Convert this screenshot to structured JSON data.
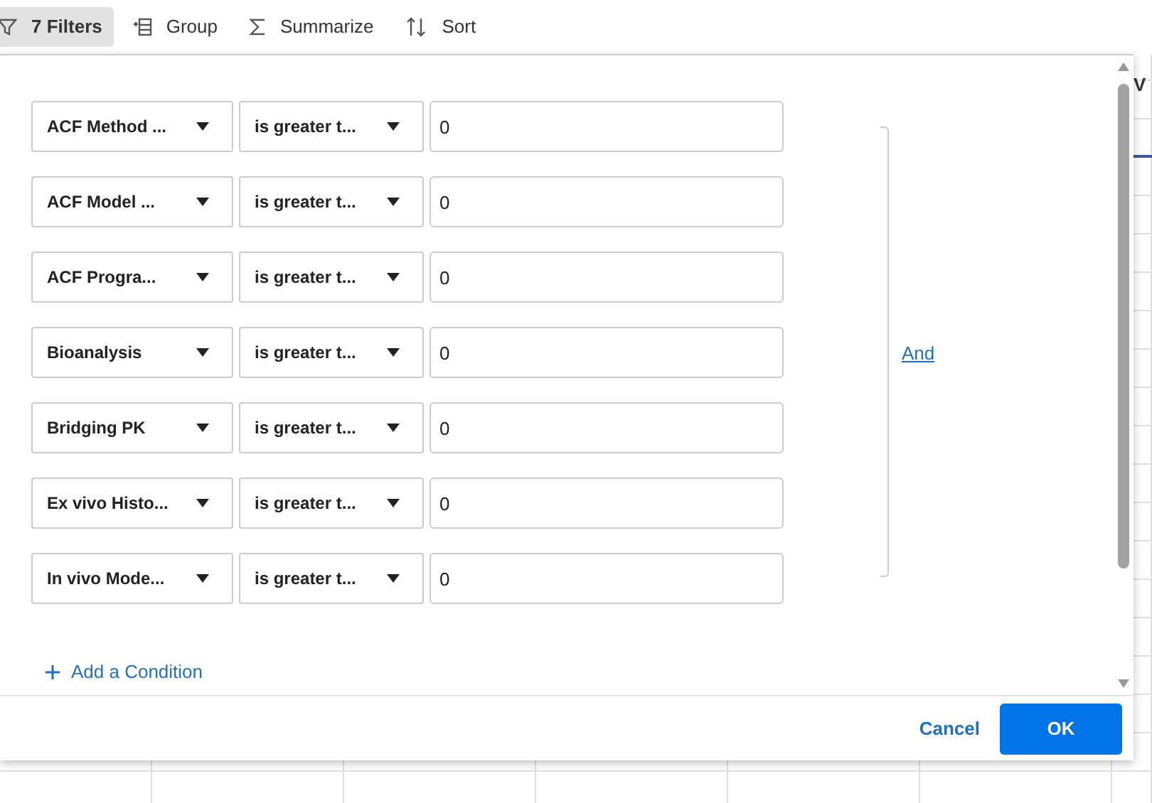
{
  "toolbar": [
    {
      "kind": "filter",
      "label": "7 Filters",
      "selected": true
    },
    {
      "kind": "group",
      "label": "Group",
      "selected": false
    },
    {
      "kind": "sum",
      "label": "Summarize",
      "selected": false
    },
    {
      "kind": "sort",
      "label": "Sort",
      "selected": false
    }
  ],
  "background_header": "V",
  "filter_dialog": {
    "conditions": [
      {
        "field": "ACF Method ...",
        "operator": "is greater t...",
        "value": "0"
      },
      {
        "field": "ACF Model ...",
        "operator": "is greater t...",
        "value": "0"
      },
      {
        "field": "ACF Progra...",
        "operator": "is greater t...",
        "value": "0"
      },
      {
        "field": "Bioanalysis",
        "operator": "is greater t...",
        "value": "0"
      },
      {
        "field": "Bridging PK",
        "operator": "is greater t...",
        "value": "0"
      },
      {
        "field": "Ex vivo Histo...",
        "operator": "is greater t...",
        "value": "0"
      },
      {
        "field": "In vivo Mode...",
        "operator": "is greater t...",
        "value": "0"
      }
    ],
    "combinator": "And",
    "add_label": "Add a Condition",
    "cancel": "Cancel",
    "ok": "OK"
  }
}
